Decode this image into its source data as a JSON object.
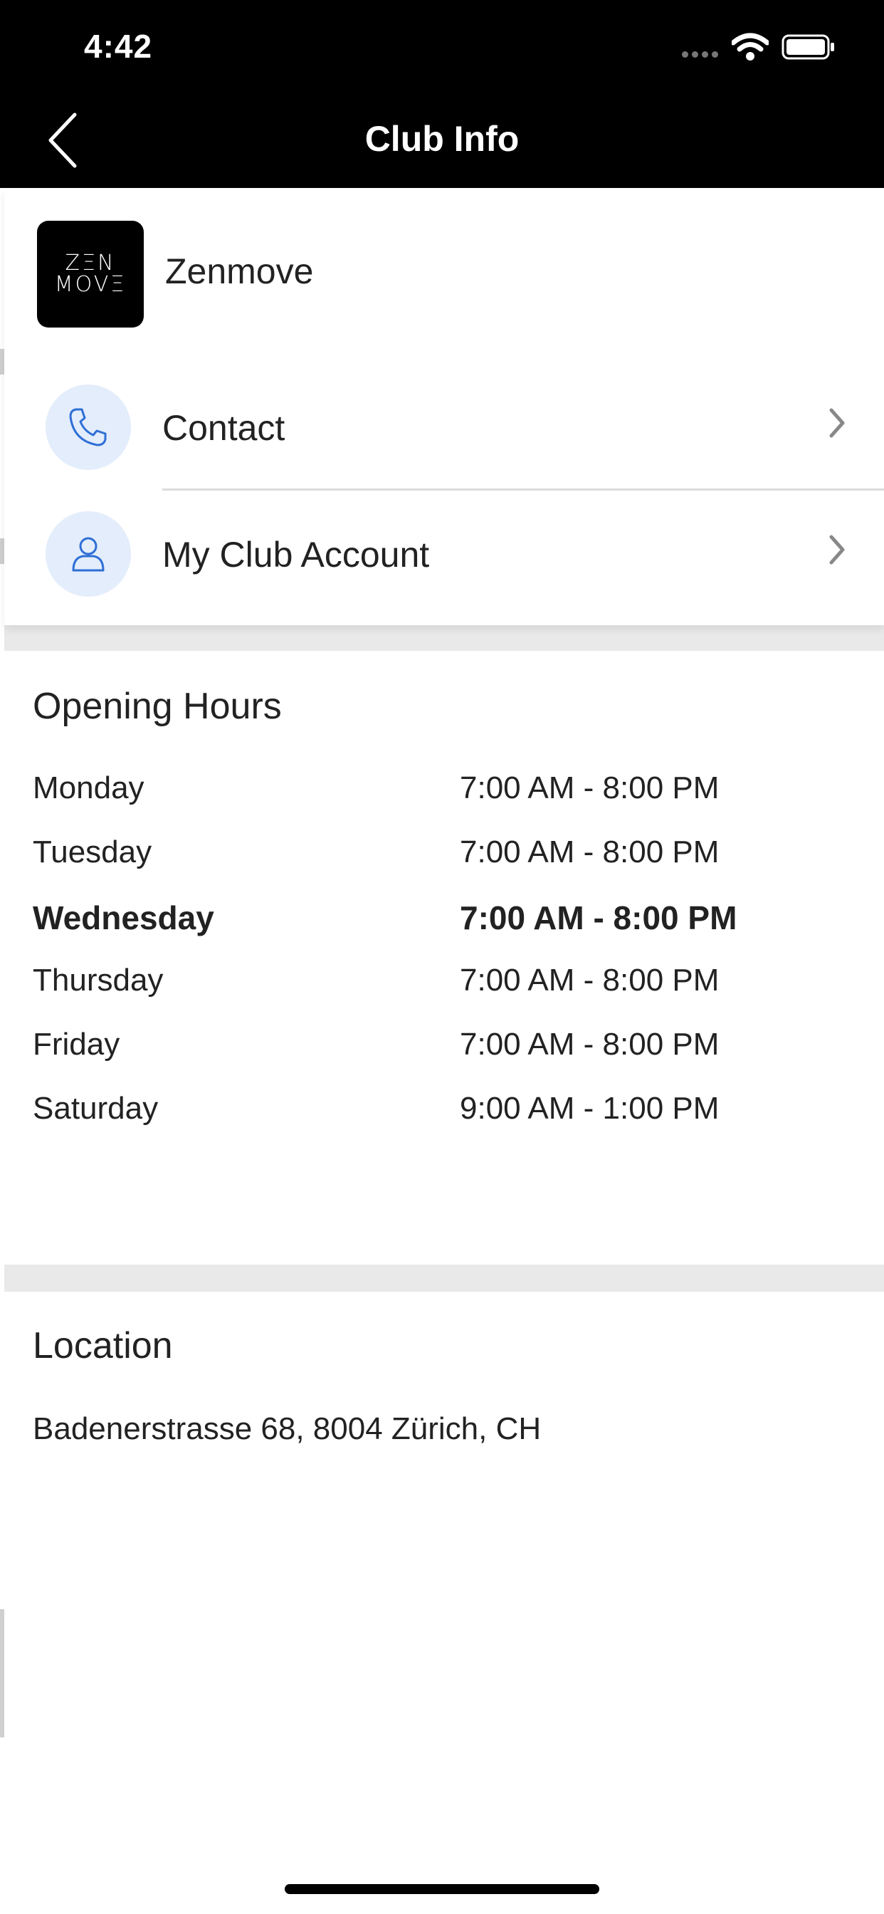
{
  "status_bar": {
    "time": "4:42"
  },
  "nav": {
    "title": "Club Info"
  },
  "club": {
    "logo_line1": "ZΞN",
    "logo_line2": "MOVΞ",
    "name": "Zenmove"
  },
  "menu": [
    {
      "label": "Contact",
      "icon": "phone-icon"
    },
    {
      "label": "My Club Account",
      "icon": "user-icon"
    }
  ],
  "opening_hours": {
    "title": "Opening Hours",
    "rows": [
      {
        "day": "Monday",
        "time": "7:00 AM - 8:00 PM"
      },
      {
        "day": "Tuesday",
        "time": "7:00 AM - 8:00 PM"
      },
      {
        "day": "Wednesday",
        "time": "7:00 AM - 8:00 PM"
      },
      {
        "day": "Thursday",
        "time": "7:00 AM - 8:00 PM"
      },
      {
        "day": "Friday",
        "time": "7:00 AM - 8:00 PM"
      },
      {
        "day": "Saturday",
        "time": "9:00 AM - 1:00 PM"
      }
    ]
  },
  "location": {
    "title": "Location",
    "address": "Badenerstrasse 68, 8004 Zürich, CH"
  },
  "colors": {
    "nav_background": "#000000",
    "icon_circle": "#e3edfb",
    "icon_stroke": "#2f6fd6"
  }
}
